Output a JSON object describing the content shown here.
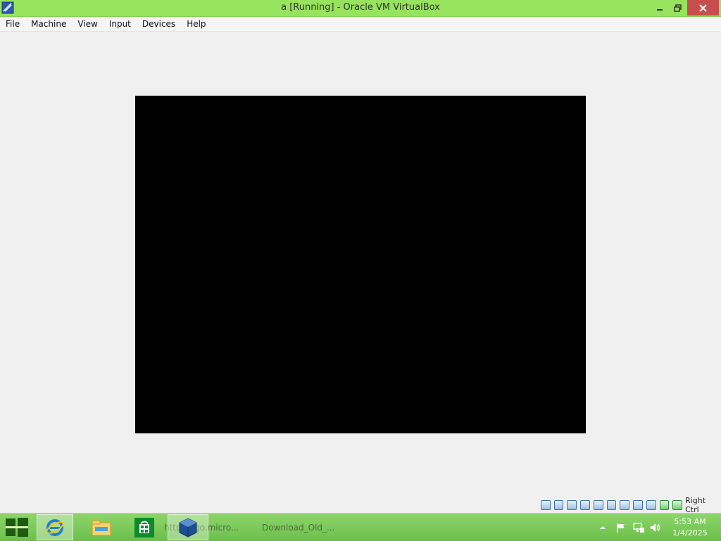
{
  "window": {
    "title": "a [Running] - Oracle VM VirtualBox",
    "icons": {
      "app": "virtualbox-app-icon",
      "minimize": "minimize-icon",
      "maximize": "restore-icon",
      "close": "close-icon"
    }
  },
  "menu": {
    "items": [
      "File",
      "Machine",
      "View",
      "Input",
      "Devices",
      "Help"
    ]
  },
  "statusbar": {
    "icons": [
      "hard-disk-icon",
      "optical-drive-icon",
      "audio-icon",
      "network-icon",
      "usb-icon",
      "shared-folders-icon",
      "display-icon",
      "video-capture-icon",
      "mouse-integration-icon",
      "cpu-icon",
      "keyboard-icon"
    ],
    "host_key": "Right Ctrl"
  },
  "taskbar": {
    "items": [
      {
        "label": "",
        "icon": "internet-explorer-icon"
      },
      {
        "label": "",
        "icon": "file-explorer-icon"
      },
      {
        "label": "",
        "icon": "store-icon"
      },
      {
        "label": "https://go.micro...",
        "icon": ""
      },
      {
        "label": "",
        "icon": "virtualbox-icon"
      },
      {
        "label": "Download_Old_...",
        "icon": ""
      }
    ],
    "clock_time": "5:53 AM",
    "clock_date": "1/4/2025"
  },
  "colors": {
    "titlebar": "#97e35d",
    "taskbar": "#7ccb5a",
    "close": "#c74e4c",
    "vm_screen": "#000000"
  }
}
